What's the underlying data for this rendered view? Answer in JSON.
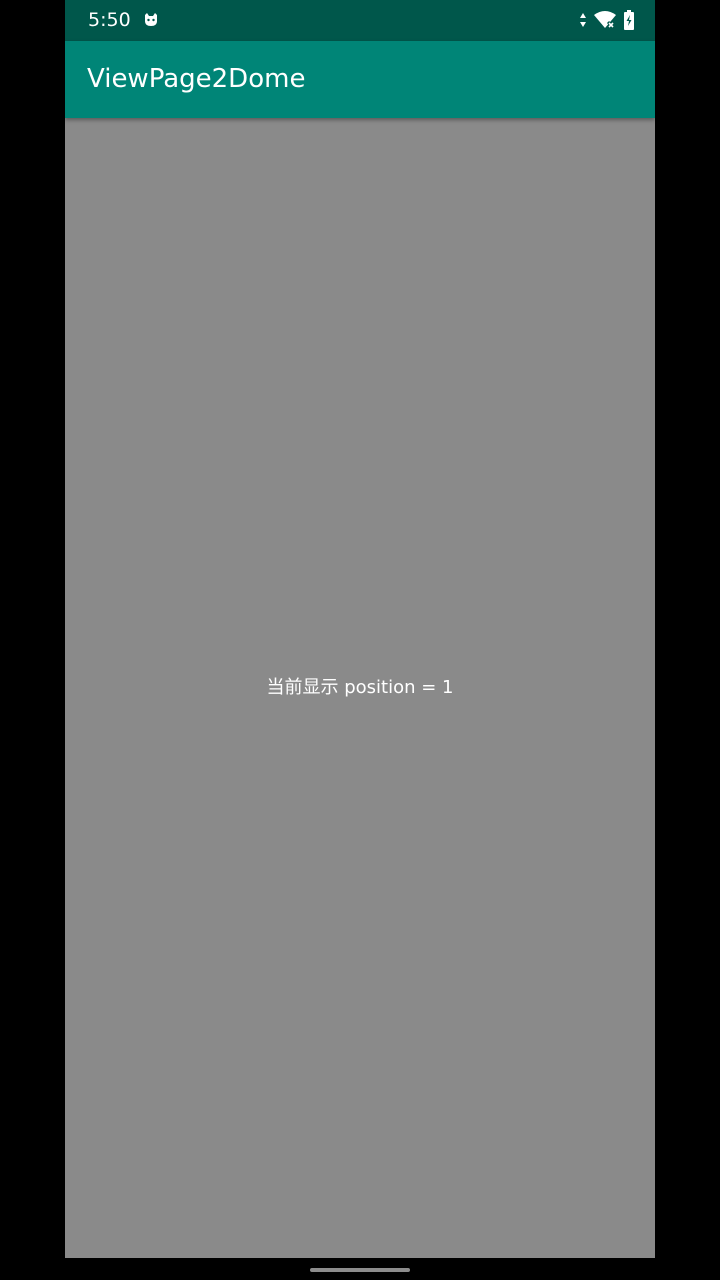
{
  "status_bar": {
    "time": "5:50",
    "notification_icon": "cat-face-icon",
    "icons": [
      "data-arrows-icon",
      "wifi-off-icon",
      "battery-charging-icon"
    ]
  },
  "app_bar": {
    "title": "ViewPage2Dome"
  },
  "page": {
    "text": "当前显示 position = 1"
  },
  "colors": {
    "status_bar": "#00574b",
    "app_bar": "#008577",
    "page_background": "#8a8a8a",
    "text": "#ffffff"
  }
}
